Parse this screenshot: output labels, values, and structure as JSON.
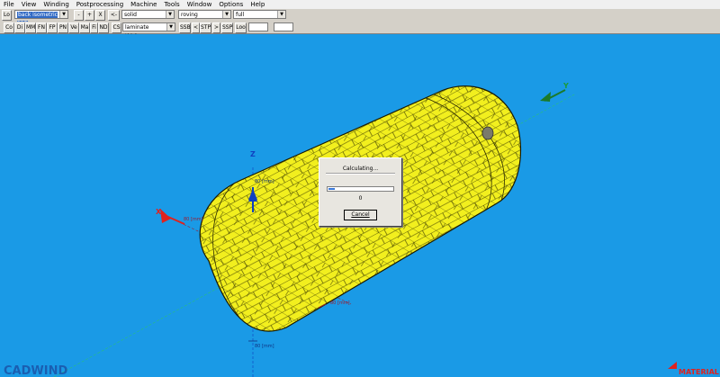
{
  "menu": [
    "File",
    "View",
    "Winding",
    "Postprocessing",
    "Machine",
    "Tools",
    "Window",
    "Options",
    "Help"
  ],
  "toolbar1": {
    "lo_label": "Lo",
    "view_select": "back isometric 315",
    "minus_label": "-",
    "plus_label": "+",
    "x_label": "X",
    "back_label": "<-",
    "display_select": "solid",
    "material_select": "roving",
    "detail_select": "full"
  },
  "toolbar2": {
    "buttons": [
      "Co",
      "Di",
      "MM",
      "FN",
      "FP",
      "PN",
      "Ve",
      "Ma",
      "Fi",
      "ND"
    ],
    "cs_label": "CS",
    "property_select": "laminate thickness",
    "ssb_label": "SSB",
    "prev_label": "<",
    "stp_label": "STP",
    "next_label": ">",
    "ssp_label": "SSP",
    "loo_label": "Loo"
  },
  "scene": {
    "axis_labels": {
      "z": "Z",
      "x": "X",
      "y": "Y"
    },
    "tick_labels": [
      "80 [mm]",
      "80 [mm]",
      "80 [mm]",
      "80 [mm]"
    ],
    "logo_left": "CADWIND",
    "logo_right": "MATERIAL"
  },
  "dialog": {
    "title": "Calculating...",
    "progress": 0.1,
    "count": "0",
    "cancel_label": "Cancel"
  },
  "colors": {
    "background": "#1a9ae6",
    "vessel": "#f2ef1e",
    "x_axis": "#e0221e",
    "y_axis": "#1b7a2a",
    "z_axis": "#1040c0"
  }
}
